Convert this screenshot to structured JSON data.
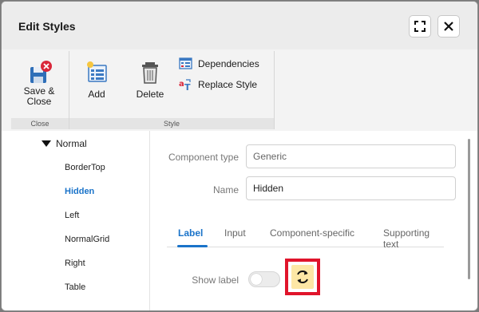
{
  "window": {
    "title": "Edit Styles"
  },
  "ribbon": {
    "save_close_line1": "Save &",
    "save_close_line2": "Close",
    "add_label": "Add",
    "delete_label": "Delete",
    "dependencies_label": "Dependencies",
    "replace_style_label": "Replace Style",
    "group_close": "Close",
    "group_style": "Style"
  },
  "tree": {
    "root": "Normal",
    "items": [
      "BorderTop",
      "Hidden",
      "Left",
      "NormalGrid",
      "Right",
      "Table"
    ],
    "selected": "Hidden"
  },
  "form": {
    "component_type_label": "Component type",
    "component_type_placeholder": "Generic",
    "name_label": "Name",
    "name_value": "Hidden",
    "tabs": [
      "Label",
      "Input",
      "Component-specific",
      "Supporting text"
    ],
    "active_tab": "Label",
    "show_label": "Show label",
    "show_label_on": false
  },
  "colors": {
    "accent": "#1a73c9",
    "highlight": "#e0142b",
    "reset_bg": "#fde7a5"
  },
  "icons": [
    "save-close-icon",
    "add-icon",
    "delete-icon",
    "dependencies-icon",
    "replace-style-icon",
    "maximize-icon",
    "close-icon",
    "reset-icon"
  ]
}
